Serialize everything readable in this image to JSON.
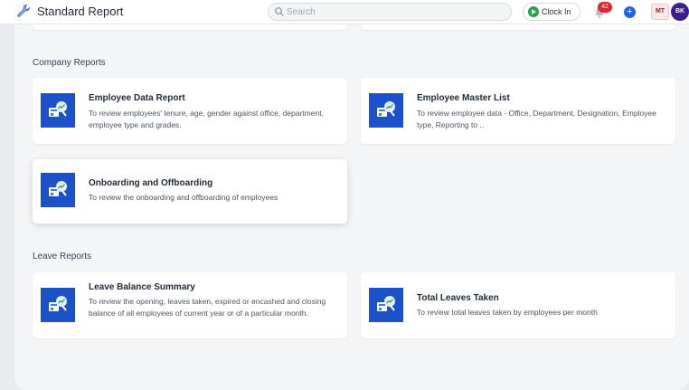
{
  "header": {
    "title": "Standard Report",
    "search_placeholder": "Search",
    "clock_in_label": "Clock In",
    "notification_count": "42",
    "add_label": "+",
    "user_initials_1": "MT",
    "user_initials_2": "BK"
  },
  "sections": {
    "company": {
      "title": "Company Reports",
      "cards": [
        {
          "title": "Employee Data Report",
          "desc": "To review employees' tenure, age, gender against office, department, employee type and grades."
        },
        {
          "title": "Employee Master List",
          "desc": "To review employee data - Office, Department, Designation, Employee type, Reporting to .."
        },
        {
          "title": "Onboarding and Offboarding",
          "desc": "To review the onboarding and offboarding of employees"
        }
      ]
    },
    "leave": {
      "title": "Leave Reports",
      "cards": [
        {
          "title": "Leave Balance Summary",
          "desc": "To review the opening, leaves taken, expired or encashed and closing balance of all employees of current year or of a particular month."
        },
        {
          "title": "Total Leaves Taken",
          "desc": "To review total leaves taken by employees per month"
        }
      ]
    }
  },
  "colors": {
    "accent": "#1d64e6",
    "card_icon_bg": "#1c52c9",
    "badge": "#e0242b",
    "clock_green": "#22a447"
  },
  "icons": {
    "app": "wrench-icon",
    "search": "search-icon",
    "clock": "play-circle-icon",
    "bell": "bell-icon",
    "report": "report-chart-icon"
  }
}
